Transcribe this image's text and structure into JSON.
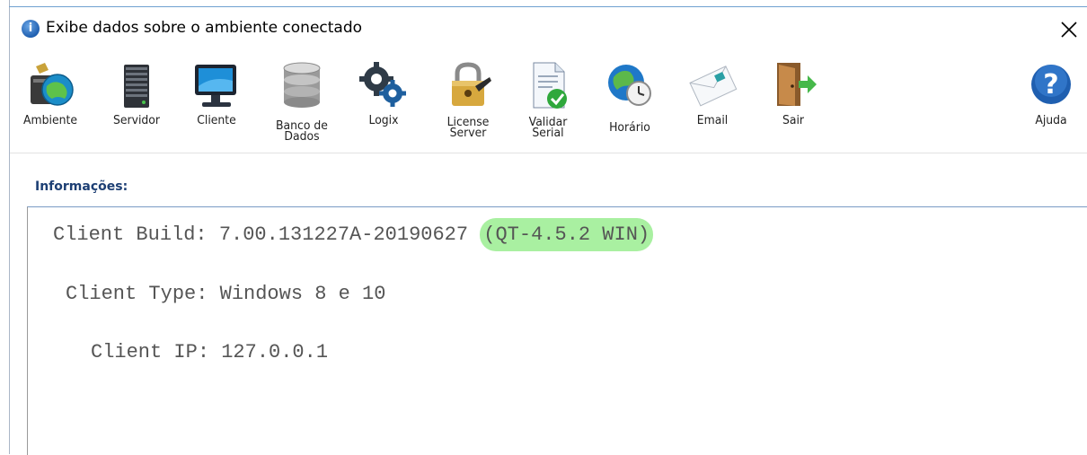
{
  "window": {
    "title": "Exibe dados sobre o ambiente conectado",
    "title_icon": "info-icon",
    "close_glyph": "✕"
  },
  "toolbar": {
    "items": [
      {
        "label": "Ambiente",
        "icon": "environment-icon"
      },
      {
        "label": "Servidor",
        "icon": "server-icon"
      },
      {
        "label": "Cliente",
        "icon": "monitor-icon"
      },
      {
        "label": "Banco de\nDados",
        "icon": "database-icon"
      },
      {
        "label": "Logix",
        "icon": "gears-icon"
      },
      {
        "label": "License\nServer",
        "icon": "lock-icon"
      },
      {
        "label": "Validar\nSerial",
        "icon": "validate-document-icon"
      },
      {
        "label": "Horário",
        "icon": "globe-clock-icon"
      },
      {
        "label": "Email",
        "icon": "envelope-icon"
      },
      {
        "label": "Sair",
        "icon": "exit-door-icon"
      },
      {
        "label": "Ajuda",
        "icon": "help-icon"
      }
    ]
  },
  "info": {
    "section_label": "Informações:",
    "client_build_prefix": "Client Build: 7.00.131227A-20190627 ",
    "client_build_highlight": "(QT-4.5.2 WIN)",
    "client_type": "Client Type: Windows 8 e 10",
    "client_ip": "Client IP: 127.0.0.1"
  },
  "colors": {
    "highlight": "#a9f0a1",
    "section_label": "#1d3f74",
    "info_text": "#555555"
  }
}
